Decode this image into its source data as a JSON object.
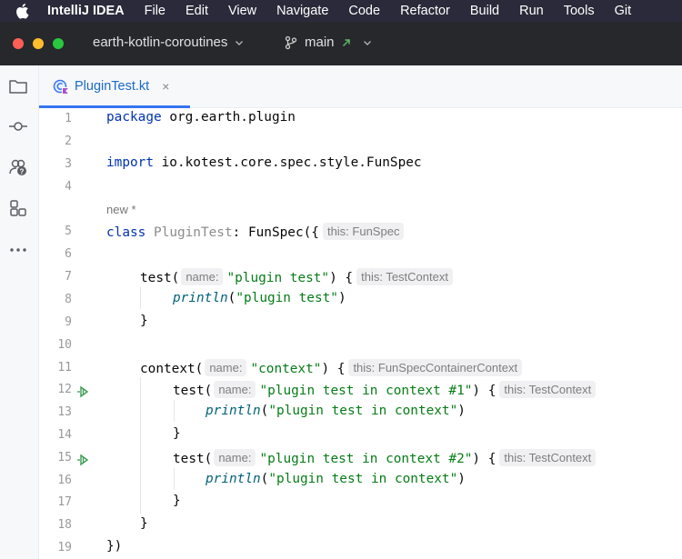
{
  "menubar": {
    "app": "IntelliJ IDEA",
    "items": [
      "File",
      "Edit",
      "View",
      "Navigate",
      "Code",
      "Refactor",
      "Build",
      "Run",
      "Tools",
      "Git"
    ]
  },
  "titlebar": {
    "project": "earth-kotlin-coroutines",
    "branch": "main"
  },
  "toolstrip": {
    "tools": [
      "folder-icon",
      "commit-icon",
      "people-help-icon",
      "structure-icon",
      "more-icon"
    ]
  },
  "tab": {
    "name": "PluginTest.kt",
    "close": "×"
  },
  "editor": {
    "annotation": "new *",
    "line_numbers": [
      "1",
      "2",
      "3",
      "4",
      "5",
      "6",
      "7",
      "8",
      "9",
      "10",
      "11",
      "12",
      "13",
      "14",
      "15",
      "16",
      "17",
      "18",
      "19"
    ],
    "l1": {
      "kw": "package",
      "rest": " org.earth.plugin"
    },
    "l3": {
      "kw": "import",
      "rest": " io.kotest.core.spec.style.FunSpec"
    },
    "l5": {
      "kw": "class",
      "name": " PluginTest",
      "rest": ": FunSpec({",
      "hint": "this: FunSpec"
    },
    "l7": {
      "fn": "test(",
      "hint_name": "name:",
      "str": "\"plugin test\"",
      "rest": ") {",
      "hint": "this: TestContext"
    },
    "l8": {
      "fn": "println",
      "args_open": "(",
      "str": "\"plugin test\"",
      "args_close": ")"
    },
    "l9": {
      "text": "}"
    },
    "l11": {
      "fn": "context(",
      "hint_name": "name:",
      "str": "\"context\"",
      "rest": ") {",
      "hint": "this: FunSpecContainerContext"
    },
    "l12": {
      "fn": "test(",
      "hint_name": "name:",
      "str": "\"plugin test in context #1\"",
      "rest": ") {",
      "hint": "this: TestContext"
    },
    "l13": {
      "fn": "println",
      "args_open": "(",
      "str": "\"plugin test in context\"",
      "args_close": ")"
    },
    "l14": {
      "text": "}"
    },
    "l15": {
      "fn": "test(",
      "hint_name": "name:",
      "str": "\"plugin test in context #2\"",
      "rest": ") {",
      "hint": "this: TestContext"
    },
    "l16": {
      "fn": "println",
      "args_open": "(",
      "str": "\"plugin test in context\"",
      "args_close": ")"
    },
    "l17": {
      "text": "}"
    },
    "l18": {
      "text": "}"
    },
    "l19": {
      "text": "})"
    }
  },
  "colors": {
    "keyword": "#0033b3",
    "string": "#067d17",
    "accent": "#3574f0"
  }
}
